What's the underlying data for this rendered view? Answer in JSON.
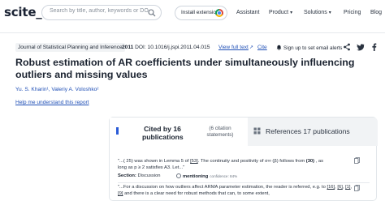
{
  "header": {
    "logo": "scite_",
    "search_placeholder": "Search by title, author, keywords or DOI",
    "install_label": "Install extension",
    "nav": [
      {
        "label": "Assistant",
        "has_dropdown": false
      },
      {
        "label": "Product",
        "has_dropdown": true
      },
      {
        "label": "Solutions",
        "has_dropdown": true
      },
      {
        "label": "Pricing",
        "has_dropdown": false
      },
      {
        "label": "Blog",
        "has_dropdown": false
      }
    ]
  },
  "paper": {
    "journal": "Journal of Statistical Planning and Inference",
    "year": "2011",
    "doi": "DOI: 10.1016/j.jspi.2011.04.015",
    "view_full": "View full text",
    "cite": "Cite",
    "signin": "Sign up to set email alerts",
    "title": "Robust estimation of AR coefficients under simultaneously influencing outliers and missing values",
    "authors": "Yu. S. Kharin¹, Valeriy A. Voloshko²",
    "help": "Help me understand this report"
  },
  "citations": {
    "cited_tab": "Cited by 16 publications",
    "cited_sub": "(6 citation statements)",
    "refs_tab": "References 17 publications",
    "snippet1": {
      "pre": "\"...( 25) was shown in Lemma 5 of ",
      "ref1": "[53]",
      "mid": ". The continuity and positivity of σ∞ (β) follows from ",
      "ref2": "(30)",
      "post": " , as long as p ≥ 2 satisfies A3. Let...\""
    },
    "section_label": "Section:",
    "section_value": "Discussion",
    "mention": "mentioning",
    "confidence": "confidence: 84%",
    "snippet2": {
      "pre": "\"...For a discussion on how outliers affect ARMA parameter estimation, the reader is referred, e.g. to ",
      "r1": "[16]",
      "r2": "[6]",
      "r3": "[1]",
      "r4": "[9]",
      "post": " and there is a clear need for robust methods that can, to some extent,"
    }
  },
  "colors": {
    "link": "#1f4fb6",
    "accent": "#2a5bd7",
    "text": "#1b2330"
  }
}
